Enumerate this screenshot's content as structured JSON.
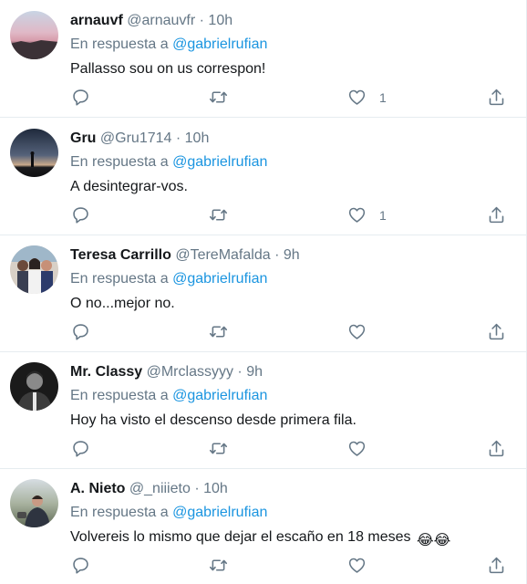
{
  "reply_prefix": "En respuesta a",
  "tweets": [
    {
      "name": "arnauvf",
      "handle": "@arnauvfr",
      "time": "10h",
      "reply_to": "@gabrielrufian",
      "text": "Pallasso sou on us correspon!",
      "like_count": "1",
      "avatar_icon": "sunset-avatar"
    },
    {
      "name": "Gru",
      "handle": "@Gru1714",
      "time": "10h",
      "reply_to": "@gabrielrufian",
      "text": "A desintegrar-vos.",
      "like_count": "1",
      "avatar_icon": "silhouette-dusk-avatar"
    },
    {
      "name": "Teresa Carrillo",
      "handle": "@TereMafalda",
      "time": "9h",
      "reply_to": "@gabrielrufian",
      "text": "O no...mejor no.",
      "like_count": "",
      "avatar_icon": "group-photo-avatar"
    },
    {
      "name": "Mr. Classy",
      "handle": "@Mrclassyyy",
      "time": "9h",
      "reply_to": "@gabrielrufian",
      "text": "Hoy ha visto el descenso desde primera fila.",
      "like_count": "",
      "avatar_icon": "man-portrait-avatar"
    },
    {
      "name": "A. Nieto",
      "handle": "@_niiieto",
      "time": "10h",
      "reply_to": "@gabrielrufian",
      "text": "Volvereis lo mismo que dejar el escaño en 18 meses",
      "emojis": "😂😂",
      "like_count": "",
      "avatar_icon": "person-outdoor-avatar"
    }
  ],
  "colors": {
    "name": "#14171a",
    "muted": "#657786",
    "link": "#1b95e0",
    "border": "#e6ecf0"
  }
}
